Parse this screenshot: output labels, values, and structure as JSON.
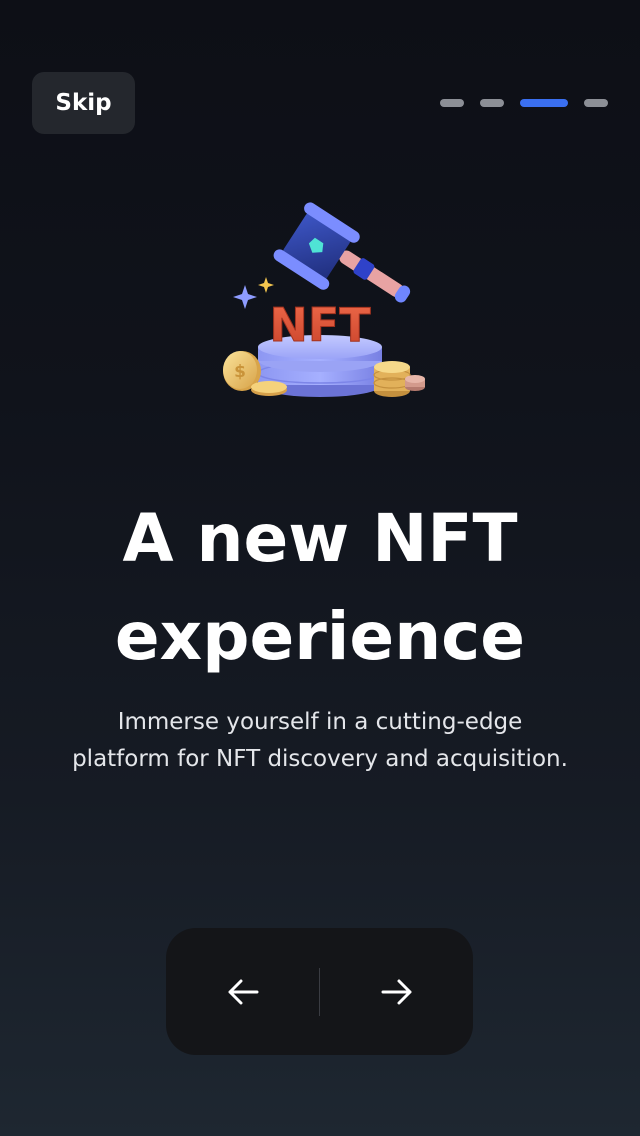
{
  "header": {
    "skip_label": "Skip"
  },
  "pager": {
    "total_pages": 4,
    "current_page": 3,
    "active_color": "#3a6ff0",
    "inactive_color": "#8c8f96"
  },
  "illustration": {
    "icon": "nft-auction-gavel-icon",
    "badge_text": "NFT"
  },
  "content": {
    "title_line1": "A new NFT",
    "title_line2": "experience",
    "subtitle_line1": "Immerse yourself in a cutting-edge",
    "subtitle_line2": "platform for NFT discovery and acquisition."
  },
  "navigation": {
    "prev_icon": "arrow-left-icon",
    "next_icon": "arrow-right-icon"
  }
}
